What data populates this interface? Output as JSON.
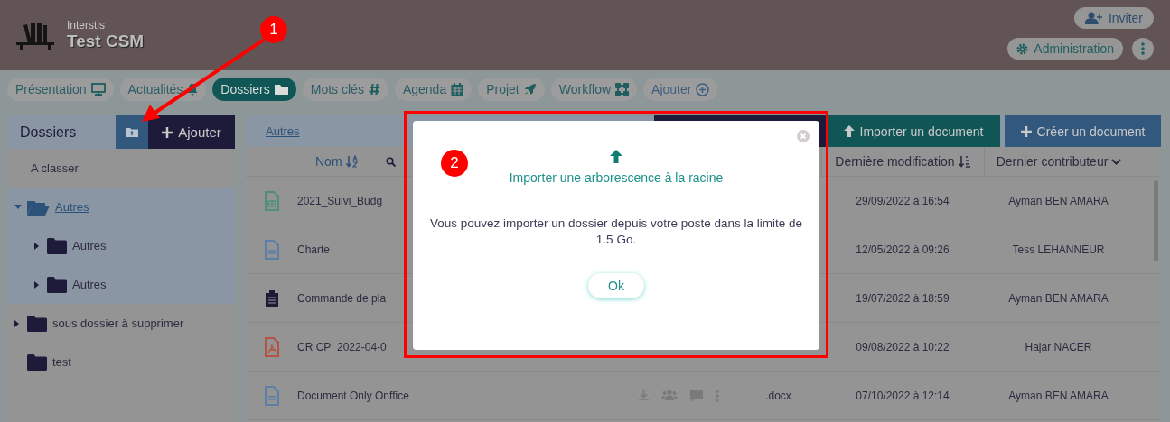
{
  "header": {
    "org": "Interstis",
    "title": "Test CSM",
    "invite_button": "Inviter",
    "admin_button": "Administration"
  },
  "tabs": [
    {
      "label": "Présentation",
      "kind": "presentation",
      "selected": false
    },
    {
      "label": "Actualités",
      "kind": "bell",
      "selected": false
    },
    {
      "label": "Dossiers",
      "kind": "folder",
      "selected": true
    },
    {
      "label": "Mots clés",
      "kind": "hash",
      "selected": false
    },
    {
      "label": "Agenda",
      "kind": "calendar",
      "selected": false
    },
    {
      "label": "Projet",
      "kind": "rocket",
      "selected": false
    },
    {
      "label": "Workflow",
      "kind": "workflow",
      "selected": false
    },
    {
      "label": "Ajouter",
      "kind": "plus",
      "selected": false
    }
  ],
  "sidebar": {
    "title": "Dossiers",
    "add_button": "Ajouter",
    "items": [
      {
        "kind": "category",
        "label": "A classer",
        "selected": false
      },
      {
        "kind": "folder",
        "label": "Autres",
        "selected": true,
        "expanded": true,
        "children": [
          {
            "kind": "folder",
            "label": "Autres",
            "selected": false,
            "expanded": false
          },
          {
            "kind": "folder",
            "label": "Autres",
            "selected": false,
            "expanded": false
          }
        ]
      },
      {
        "kind": "folder",
        "label": "sous dossier à supprimer",
        "selected": false,
        "expanded": false
      },
      {
        "kind": "folder",
        "label": "test",
        "selected": false
      }
    ]
  },
  "breadcrumb": "Autres",
  "toolbar": {
    "import_button": "Importer un document",
    "create_button": "Créer un document"
  },
  "table": {
    "columns": {
      "name": "Nom",
      "modified": "Dernière modification",
      "contributor": "Dernier contributeur"
    },
    "rows": [
      {
        "kind": "sheet",
        "name": "2021_Suivi_Budg",
        "modified": "29/09/2022 à 16:54",
        "contributor": "Ayman BEN AMARA"
      },
      {
        "kind": "doc",
        "name": "Charte",
        "modified": "12/05/2022 à 09:26",
        "contributor": "Tess LEHANNEUR"
      },
      {
        "kind": "list",
        "name": "Commande de pla",
        "modified": "19/07/2022 à 18:59",
        "contributor": "Ayman BEN AMARA"
      },
      {
        "kind": "pdf",
        "name": "CR CP_2022-04-0",
        "modified": "09/08/2022 à 10:22",
        "contributor": "Hajar NACER"
      },
      {
        "kind": "doc",
        "name": "Document Only Onffice",
        "ext": ".docx",
        "actions": true,
        "modified": "07/10/2022 à 12:14",
        "contributor": "Ayman BEN AMARA"
      }
    ]
  },
  "dialog": {
    "title": "Importer une arborescence à la racine",
    "message": "Vous pouvez importer un dossier depuis votre poste dans la limite de 1.5 Go.",
    "ok_button": "Ok"
  },
  "annotations": [
    "1",
    "2"
  ]
}
